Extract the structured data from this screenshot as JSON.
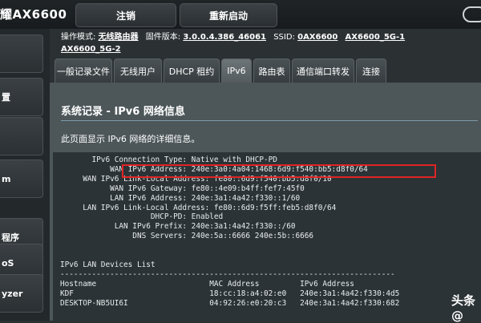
{
  "header": {
    "brand": "耀AX6600",
    "logout_label": "注销",
    "reboot_label": "重新启动"
  },
  "sidebar": {
    "items": [
      {
        "label": ""
      },
      {
        "label": "置"
      },
      {
        "label": ""
      },
      {
        "label": "m"
      },
      {
        "label": "程序"
      },
      {
        "label": "oS"
      },
      {
        "label": "yzer"
      }
    ]
  },
  "status": {
    "mode_label": "操作模式:",
    "mode_value": "无线路由器",
    "firmware_label": "固件版本:",
    "firmware_value": "3.0.0.4.386_46061",
    "ssid_label": "SSID:",
    "ssid_values": [
      "0AX6600",
      "AX6600_5G-1",
      "AX6600_5G-2"
    ]
  },
  "tabs": [
    {
      "label": "一般记录文件"
    },
    {
      "label": "无线用户"
    },
    {
      "label": "DHCP 租约"
    },
    {
      "label": "IPv6"
    },
    {
      "label": "路由表"
    },
    {
      "label": "通信端口转发"
    },
    {
      "label": "连接"
    }
  ],
  "main": {
    "title": "系统记录 - IPv6 网络信息",
    "description": "此页面显示 IPv6 网络的详细信息。"
  },
  "log": {
    "text": "       IPv6 Connection Type: Native with DHCP-PD\n           WAN IPv6 Address: 240e:3a0:4a04:1468:6d9:f540:bb5:d8f0/64\n     WAN IPv6 Link-Local Address: fe80::6d9:f540:bb5:d8f0/10\n           WAN IPv6 Gateway: fe80::4e09:b4ff:fef7:45f0\n           LAN IPv6 Address: 240e:3a1:4a42:f330::1/60\n     LAN IPv6 Link-Local Address: fe80::6d9:f5ff:feb5:d8f0/64\n                    DHCP-PD: Enabled\n            LAN IPv6 Prefix: 240e:3a1:4a42:f330::/60\n                DNS Servers: 240e:5a::6666 240e:5b::6666\n\n\nIPv6 LAN Devices List\n--------------------------------------------------------------------------\nHostname                         MAC Address         IPv6 Address\nKDF                              18:cc:18:a4:02:e0   240e:3a1:4a42:f330:4d5\nDESKTOP-NB5UI6I                  04:92:26:e0:20:c3   240e:3a1:4a42:f330:682"
  },
  "watermark": "头条@"
}
